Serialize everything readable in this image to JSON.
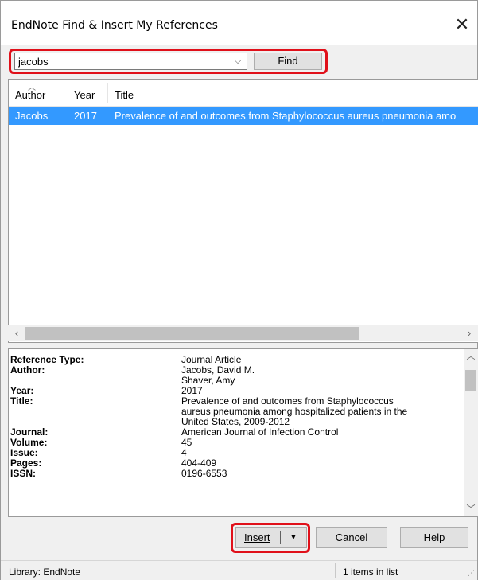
{
  "window": {
    "title": "EndNote Find & Insert My References",
    "close_glyph": "✕"
  },
  "search": {
    "value": "jacobs",
    "dropdown_glyph": "⌵",
    "find_label": "Find"
  },
  "list": {
    "sort_glyph": "︿",
    "columns": [
      "Author",
      "Year",
      "Title"
    ],
    "rows": [
      {
        "author": "Jacobs",
        "year": "2017",
        "title": "Prevalence of and outcomes from Staphylococcus aureus pneumonia amo",
        "selected": true
      }
    ]
  },
  "hscroll": {
    "left_glyph": "‹",
    "right_glyph": "›"
  },
  "details": {
    "fields": [
      {
        "label": "Reference Type:",
        "value": "Journal Article"
      },
      {
        "label": "Author:",
        "value": "Jacobs, David M."
      },
      {
        "label": "",
        "value": "Shaver, Amy"
      },
      {
        "label": "Year:",
        "value": "2017"
      },
      {
        "label": "Title:",
        "value": "Prevalence of and outcomes from Staphylococcus"
      },
      {
        "label": "",
        "value": "aureus pneumonia among hospitalized patients in the"
      },
      {
        "label": "",
        "value": "United States, 2009-2012"
      },
      {
        "label": "Journal:",
        "value": "American Journal of Infection Control"
      },
      {
        "label": "Volume:",
        "value": "45"
      },
      {
        "label": "Issue:",
        "value": "4"
      },
      {
        "label": "Pages:",
        "value": "404-409"
      },
      {
        "label": "ISSN:",
        "value": "0196-6553"
      }
    ],
    "scroll_up_glyph": "︿",
    "scroll_down_glyph": "﹀"
  },
  "buttons": {
    "insert": "Insert",
    "insert_dropdown": "▼",
    "cancel": "Cancel",
    "help": "Help"
  },
  "status": {
    "library": "Library: EndNote",
    "count": "1 items in list",
    "grip": "⋰"
  },
  "colors": {
    "selection": "#3399ff",
    "highlight_outline": "#e0101a"
  }
}
